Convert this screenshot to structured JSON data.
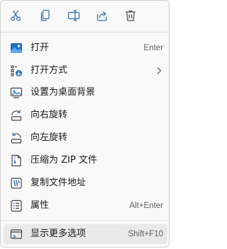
{
  "accent": "#1a6fc4",
  "toolbar": {
    "buttons": [
      {
        "icon": "cut-icon"
      },
      {
        "icon": "copy-icon"
      },
      {
        "icon": "rename-icon"
      },
      {
        "icon": "share-icon"
      },
      {
        "icon": "delete-icon"
      }
    ]
  },
  "menu": {
    "open": {
      "label": "打开",
      "shortcut": "Enter",
      "icon": "image-icon"
    },
    "open_with": {
      "label": "打开方式",
      "icon": "open-with-icon",
      "has_submenu": true
    },
    "set_wallpaper": {
      "label": "设置为桌面背景",
      "icon": "wallpaper-icon"
    },
    "rotate_right": {
      "label": "向右旋转",
      "icon": "rotate-right-icon"
    },
    "rotate_left": {
      "label": "向左旋转",
      "icon": "rotate-left-icon"
    },
    "compress_zip": {
      "label": "压缩为 ZIP 文件",
      "icon": "zip-icon"
    },
    "copy_path": {
      "label": "复制文件地址",
      "icon": "copy-path-icon"
    },
    "properties": {
      "label": "属性",
      "shortcut": "Alt+Enter",
      "icon": "properties-icon"
    },
    "show_more": {
      "label": "显示更多选项",
      "shortcut": "Shift+F10",
      "icon": "more-options-icon"
    }
  }
}
